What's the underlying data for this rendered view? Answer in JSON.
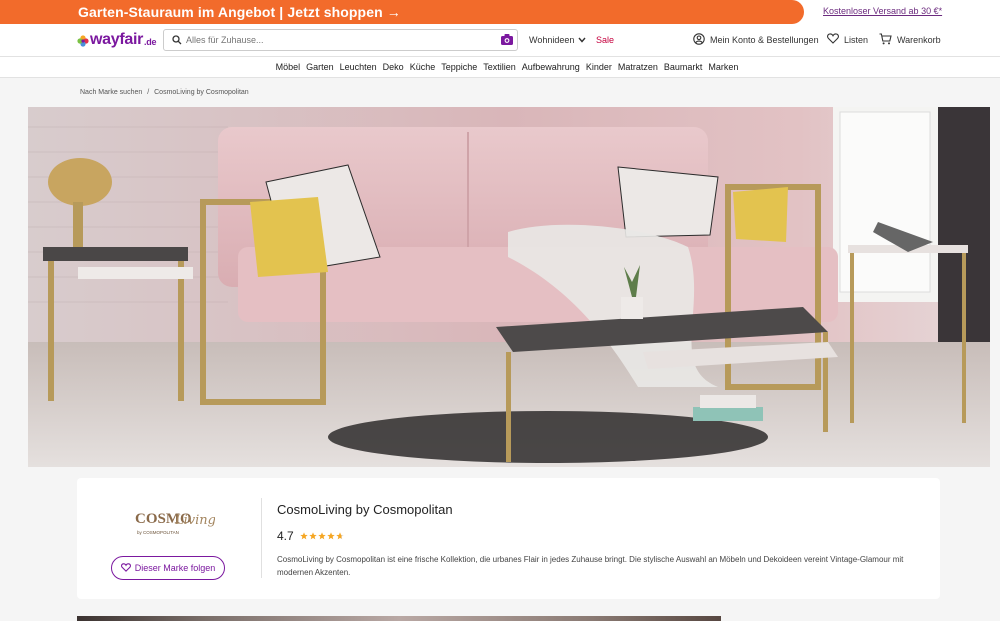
{
  "promo": {
    "text": "Garten-Stauraum im Angebot | Jetzt shoppen →",
    "shipping": "Kostenloser Versand ab 30 €*"
  },
  "header": {
    "logo": "wayfair",
    "logo_suffix": ".de",
    "search_placeholder": "Alles für Zuhause...",
    "nav_ideas": "Wohnideen",
    "nav_sale": "Sale",
    "account": "Mein Konto & Bestellungen",
    "lists": "Listen",
    "cart": "Warenkorb"
  },
  "categories": [
    "Möbel",
    "Garten",
    "Leuchten",
    "Deko",
    "Küche",
    "Teppiche",
    "Textilien",
    "Aufbewahrung",
    "Kinder",
    "Matratzen",
    "Baumarkt",
    "Marken"
  ],
  "breadcrumb": {
    "parent": "Nach Marke suchen",
    "separator": "/",
    "current": "CosmoLiving by Cosmopolitan"
  },
  "brand": {
    "logo_text_main": "COSMO",
    "logo_text_script": "Living",
    "logo_subtext": "by COSMOPOLITAN",
    "follow_label": "Dieser Marke folgen",
    "name": "CosmoLiving by Cosmopolitan",
    "rating": "4.7",
    "rating_value": 4.7,
    "description": "CosmoLiving by Cosmopolitan ist eine frische Kollektion, die urbanes Flair in jedes Zuhause bringt. Die stylische Auswahl an Möbeln und Dekoideen vereint Vintage-Glamour mit modernen Akzenten."
  },
  "colors": {
    "brand_purple": "#7b189f",
    "promo_orange": "#f26b2b",
    "sale_red": "#c6003e",
    "star_gold": "#f5a623"
  }
}
